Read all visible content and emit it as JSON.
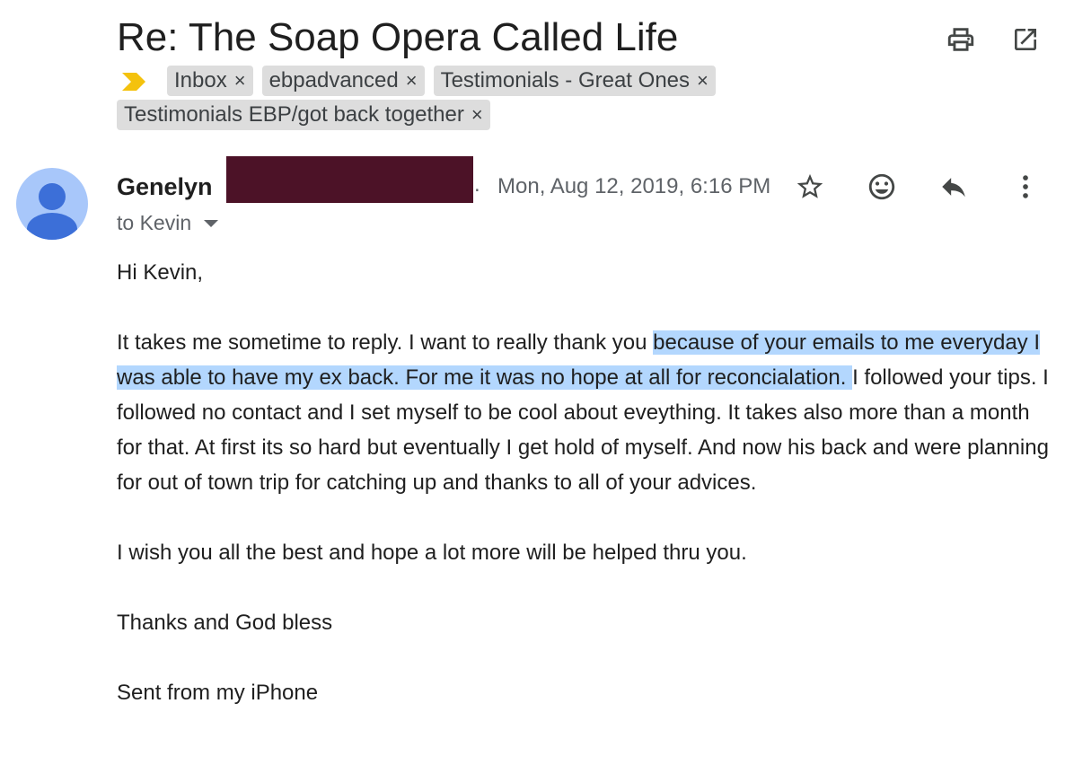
{
  "email": {
    "subject": "Re: The Soap Opera Called Life",
    "labels": [
      {
        "name": "Inbox",
        "remove": "×"
      },
      {
        "name": "ebpadvanced",
        "remove": "×"
      },
      {
        "name": "Testimonials - Great Ones",
        "remove": "×"
      },
      {
        "name": "Testimonials EBP/got back together",
        "remove": "×"
      }
    ],
    "sender": {
      "name": "Genelyn",
      "trailing": "."
    },
    "date": "Mon, Aug 12, 2019, 6:16 PM",
    "recipient": "to Kevin",
    "body": {
      "greeting": "Hi Kevin,",
      "para1_before": "It takes me sometime to reply. I want to really thank you ",
      "para1_highlight": "because of your emails to me everyday I was able to have my ex back. For me it was no hope at all for reconcialation. ",
      "para1_after": "I followed your tips. I followed no contact and I set myself to be cool about eveything. It takes also more than a month for that. At first its so hard but eventually I get hold of myself. And now his back and were planning for out of town trip for catching up and thanks to all of your advices.",
      "para2": "I wish you all the best and hope a lot more will be helped thru you.",
      "closing": "Thanks and God bless",
      "signature": "Sent from my iPhone"
    }
  },
  "icons": {
    "print": "print-icon",
    "open_new_window": "open-in-new-window-icon",
    "importance": "importance-marker-icon",
    "star": "star-icon",
    "emoji": "emoji-reaction-icon",
    "reply": "reply-icon",
    "more": "more-vertical-icon",
    "avatar": "default-avatar-icon"
  },
  "colors": {
    "importance": "#f4c20d",
    "avatar_bg": "#a8c7fa",
    "avatar_fg": "#3c6fd8",
    "redaction": "#4c1227",
    "selection_highlight": "#b3d7fe",
    "chip_bg": "#dddddd"
  }
}
